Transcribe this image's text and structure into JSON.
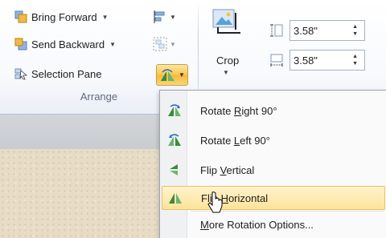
{
  "arrange": {
    "bring_forward": "Bring Forward",
    "send_backward": "Send Backward",
    "selection_pane": "Selection Pane",
    "group_label": "Arrange"
  },
  "size": {
    "crop_label": "Crop",
    "height_value": "3.58\"",
    "width_value": "3.58\""
  },
  "rotate_menu": {
    "items": [
      {
        "label": "Rotate Right 90°",
        "icon": "rotate-right-icon",
        "accel_index": 7
      },
      {
        "label": "Rotate Left 90°",
        "icon": "rotate-left-icon",
        "accel_index": 7
      },
      {
        "label": "Flip Vertical",
        "icon": "flip-vertical-icon",
        "accel_index": 5
      },
      {
        "label": "Flip Horizontal",
        "icon": "flip-horizontal-icon",
        "accel_index": 5,
        "highlighted": true
      },
      {
        "label": "More Rotation Options...",
        "icon": "",
        "accel_index": 0
      }
    ]
  },
  "colors": {
    "highlight": "#fde39a",
    "rotate_button": "#f9c64f",
    "accent_blue": "#1f6cc4"
  }
}
